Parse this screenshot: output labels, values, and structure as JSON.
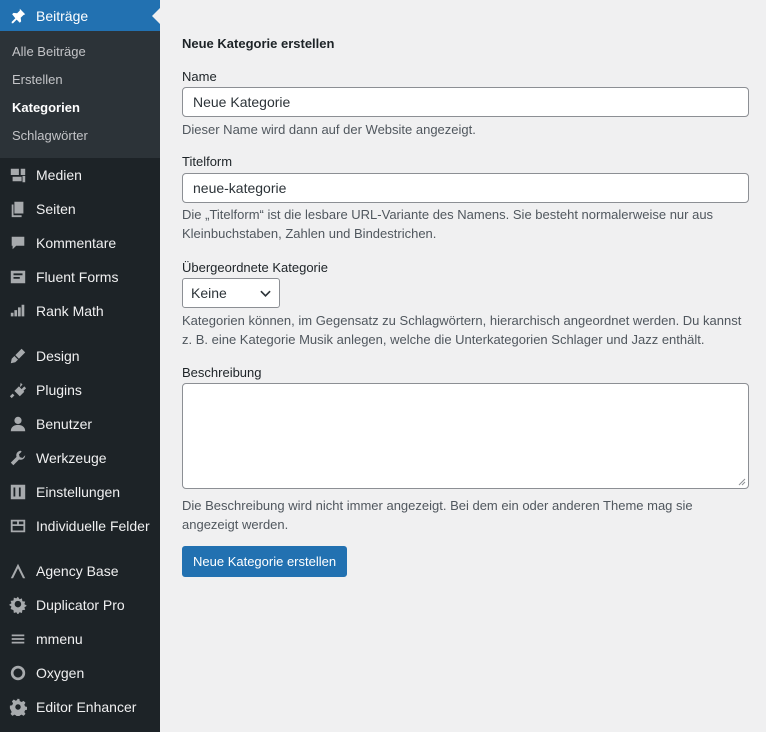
{
  "sidebar": {
    "current": {
      "label": "Beiträge",
      "icon": "pin-icon"
    },
    "submenu": [
      {
        "label": "Alle Beiträge",
        "active": false
      },
      {
        "label": "Erstellen",
        "active": false
      },
      {
        "label": "Kategorien",
        "active": true
      },
      {
        "label": "Schlagwörter",
        "active": false
      }
    ],
    "items": [
      {
        "label": "Medien",
        "icon": "media-icon"
      },
      {
        "label": "Seiten",
        "icon": "pages-icon"
      },
      {
        "label": "Kommentare",
        "icon": "comments-icon"
      },
      {
        "label": "Fluent Forms",
        "icon": "forms-icon"
      },
      {
        "label": "Rank Math",
        "icon": "rank-math-icon"
      },
      {
        "label": "Design",
        "icon": "brush-icon"
      },
      {
        "label": "Plugins",
        "icon": "plugin-icon"
      },
      {
        "label": "Benutzer",
        "icon": "user-icon"
      },
      {
        "label": "Werkzeuge",
        "icon": "wrench-icon"
      },
      {
        "label": "Einstellungen",
        "icon": "settings-icon"
      },
      {
        "label": "Individuelle Felder",
        "icon": "fields-icon"
      },
      {
        "label": "Agency Base",
        "icon": "agency-icon"
      },
      {
        "label": "Duplicator Pro",
        "icon": "duplicator-icon"
      },
      {
        "label": "mmenu",
        "icon": "menu-icon"
      },
      {
        "label": "Oxygen",
        "icon": "oxygen-icon"
      },
      {
        "label": "Editor Enhancer",
        "icon": "gear-icon"
      }
    ]
  },
  "form": {
    "title": "Neue Kategorie erstellen",
    "name_label": "Name",
    "name_value": "Neue Kategorie",
    "name_desc": "Dieser Name wird dann auf der Website angezeigt.",
    "slug_label": "Titelform",
    "slug_value": "neue-kategorie",
    "slug_desc": "Die „Titelform“ ist die lesbare URL-Variante des Namens. Sie besteht normalerweise nur aus Kleinbuchstaben, Zahlen und Bindestrichen.",
    "parent_label": "Übergeordnete Kategorie",
    "parent_value": "Keine",
    "parent_desc": "Kategorien können, im Gegensatz zu Schlagwörtern, hierarchisch angeordnet werden. Du kannst z. B. eine Kategorie Musik anlegen, welche die Unterkategorien Schlager und Jazz enthält.",
    "desc_label": "Beschreibung",
    "desc_value": "",
    "desc_desc": "Die Beschreibung wird nicht immer angezeigt. Bei dem ein oder anderen Theme mag sie angezeigt werden.",
    "submit_label": "Neue Kategorie erstellen"
  },
  "colors": {
    "accent": "#2271b1",
    "sidebar": "#1d2327",
    "submenu": "#2c3338"
  }
}
